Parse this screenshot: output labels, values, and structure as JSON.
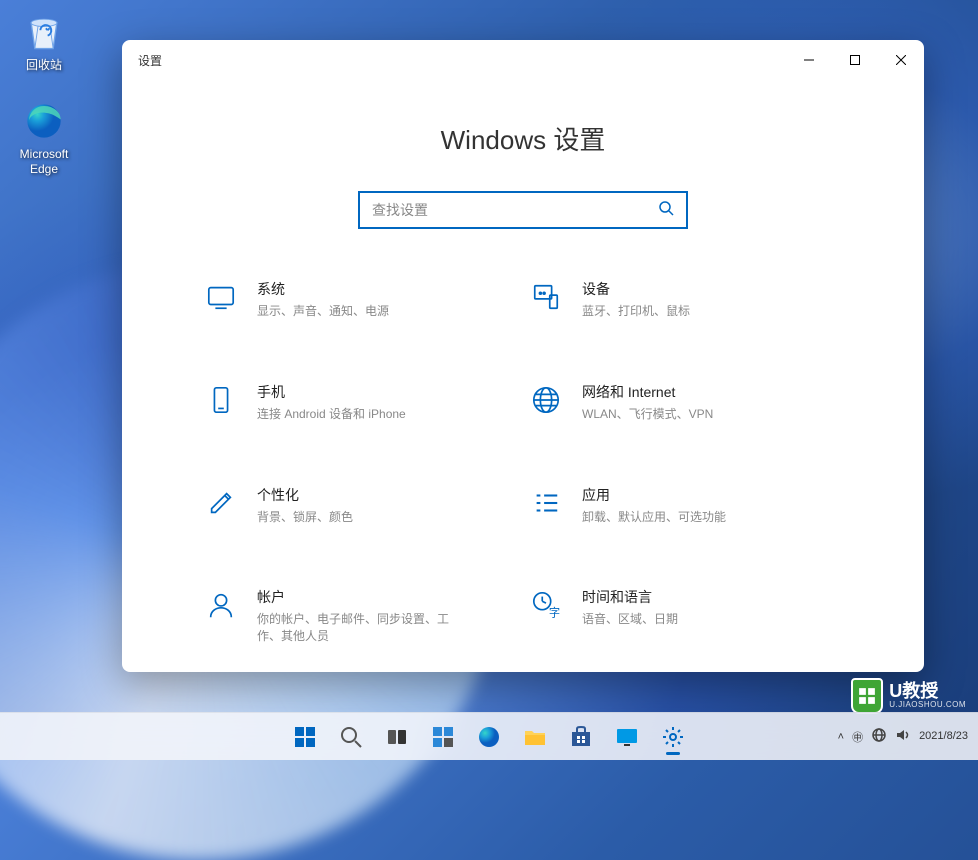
{
  "desktop": {
    "icons": [
      {
        "name": "recycle-bin",
        "label": "回收站"
      },
      {
        "name": "edge",
        "label": "Microsoft\nEdge"
      }
    ]
  },
  "window": {
    "title": "设置",
    "page_title": "Windows 设置",
    "search": {
      "placeholder": "查找设置"
    },
    "categories": [
      {
        "id": "system",
        "title": "系统",
        "sub": "显示、声音、通知、电源"
      },
      {
        "id": "devices",
        "title": "设备",
        "sub": "蓝牙、打印机、鼠标"
      },
      {
        "id": "phone",
        "title": "手机",
        "sub": "连接 Android 设备和 iPhone"
      },
      {
        "id": "network",
        "title": "网络和 Internet",
        "sub": "WLAN、飞行模式、VPN"
      },
      {
        "id": "personalization",
        "title": "个性化",
        "sub": "背景、锁屏、颜色"
      },
      {
        "id": "apps",
        "title": "应用",
        "sub": "卸载、默认应用、可选功能"
      },
      {
        "id": "accounts",
        "title": "帐户",
        "sub": "你的帐户、电子邮件、同步设置、工作、其他人员"
      },
      {
        "id": "time",
        "title": "时间和语言",
        "sub": "语音、区域、日期"
      }
    ]
  },
  "taskbar": {
    "time": "",
    "date": "2021/8/23"
  },
  "watermark": {
    "brand": "U教授",
    "sub": "U.JIAOSHOU.COM"
  }
}
